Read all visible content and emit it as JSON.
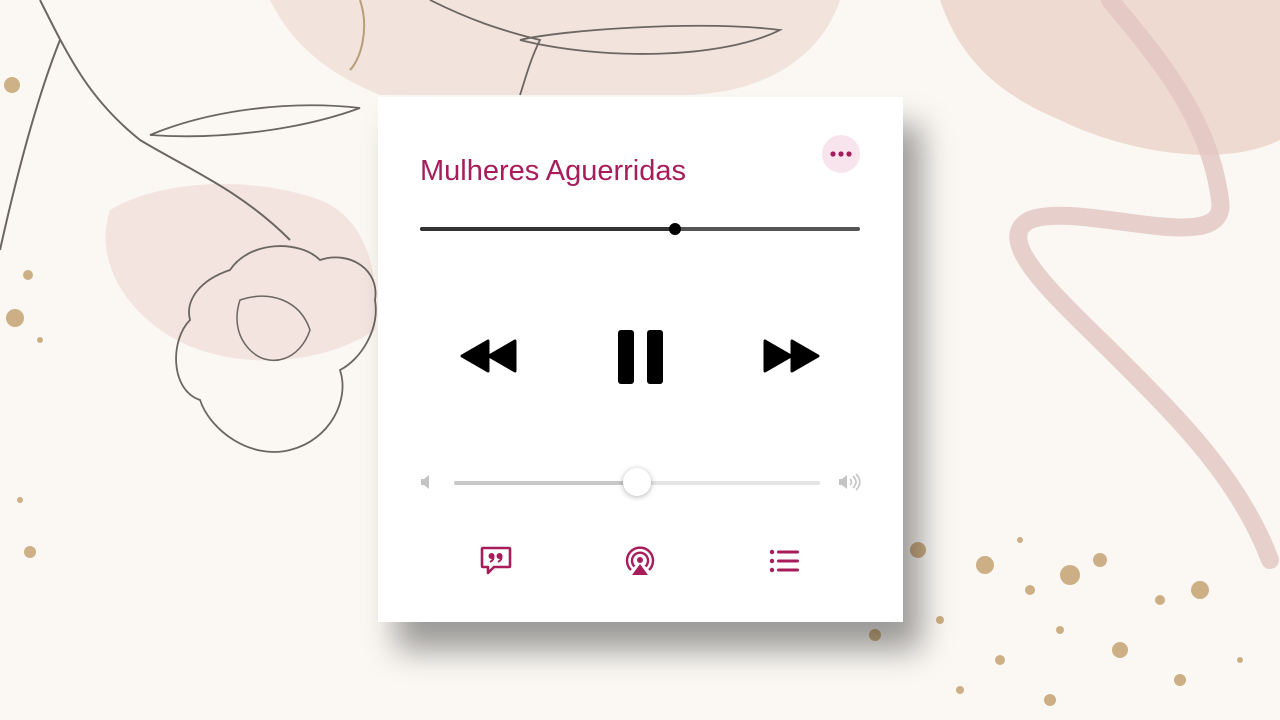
{
  "player": {
    "title": "Mulheres Aguerridas",
    "progress_fraction": 0.58,
    "volume_fraction": 0.5
  },
  "colors": {
    "accent": "#a81c5b",
    "accent_light": "#f7e4ec",
    "background": "#fbf8f4"
  },
  "icons": {
    "more": "ellipsis-icon",
    "rewind": "rewind-icon",
    "pause": "pause-icon",
    "forward": "fast-forward-icon",
    "volume_min": "speaker-low-icon",
    "volume_max": "speaker-high-icon",
    "lyrics": "lyrics-quote-icon",
    "airplay": "airplay-icon",
    "queue": "list-icon"
  }
}
